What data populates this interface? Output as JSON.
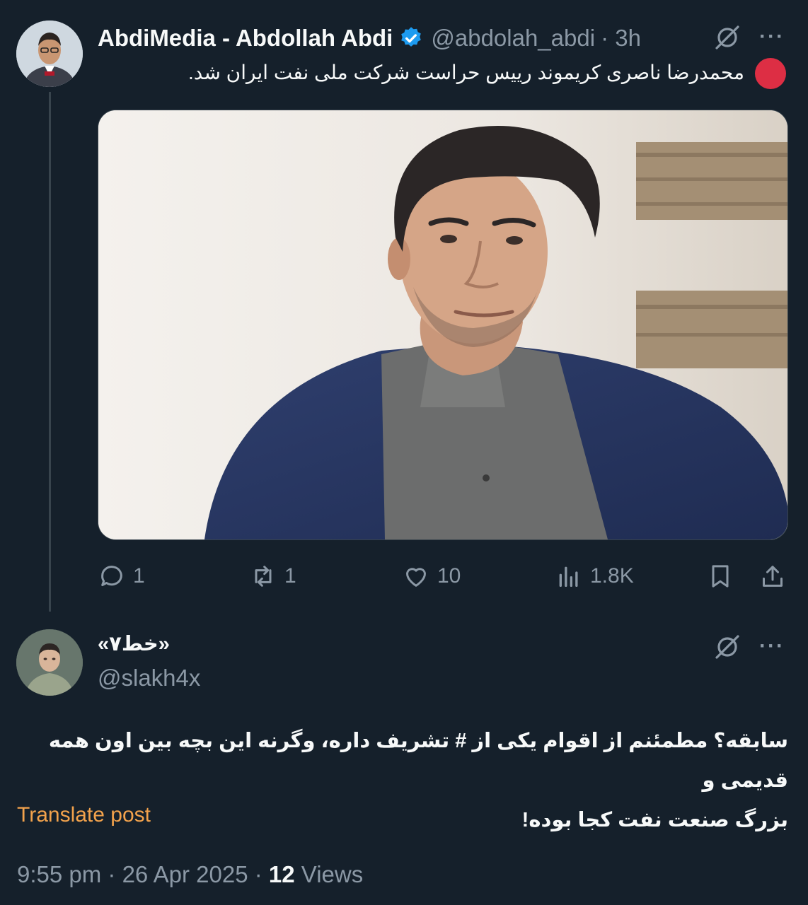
{
  "tweet": {
    "author_name": "AbdiMedia - Abdollah Abdi",
    "handle": "@abdolah_abdi",
    "time": "· 3h",
    "text": "محمدرضا ناصری کریموند رییس حراست شرکت ملی نفت ایران شد.",
    "more_label": "···",
    "stats": {
      "replies": "1",
      "reposts": "1",
      "likes": "10",
      "views": "1.8K"
    }
  },
  "reply": {
    "author_name": "«خط۷»",
    "handle": "@slakh4x",
    "more_label": "···",
    "text_line1": "سابقه؟ مطمئنم از اقوام یکی از # تشریف داره، وگرنه این بچه بین اون همه قدیمی و",
    "text_line2": "بزرگ صنعت نفت کجا بوده!",
    "translate_label": "Translate post",
    "timestamp": "9:55 pm · 26 Apr 2025 · ",
    "views_count": "12",
    "views_label": " Views"
  },
  "colors": {
    "background": "#15202b",
    "muted": "#8b98a5",
    "verified": "#1d9bf0",
    "translate": "#f2a24c",
    "red_dot": "#dd2e44"
  }
}
